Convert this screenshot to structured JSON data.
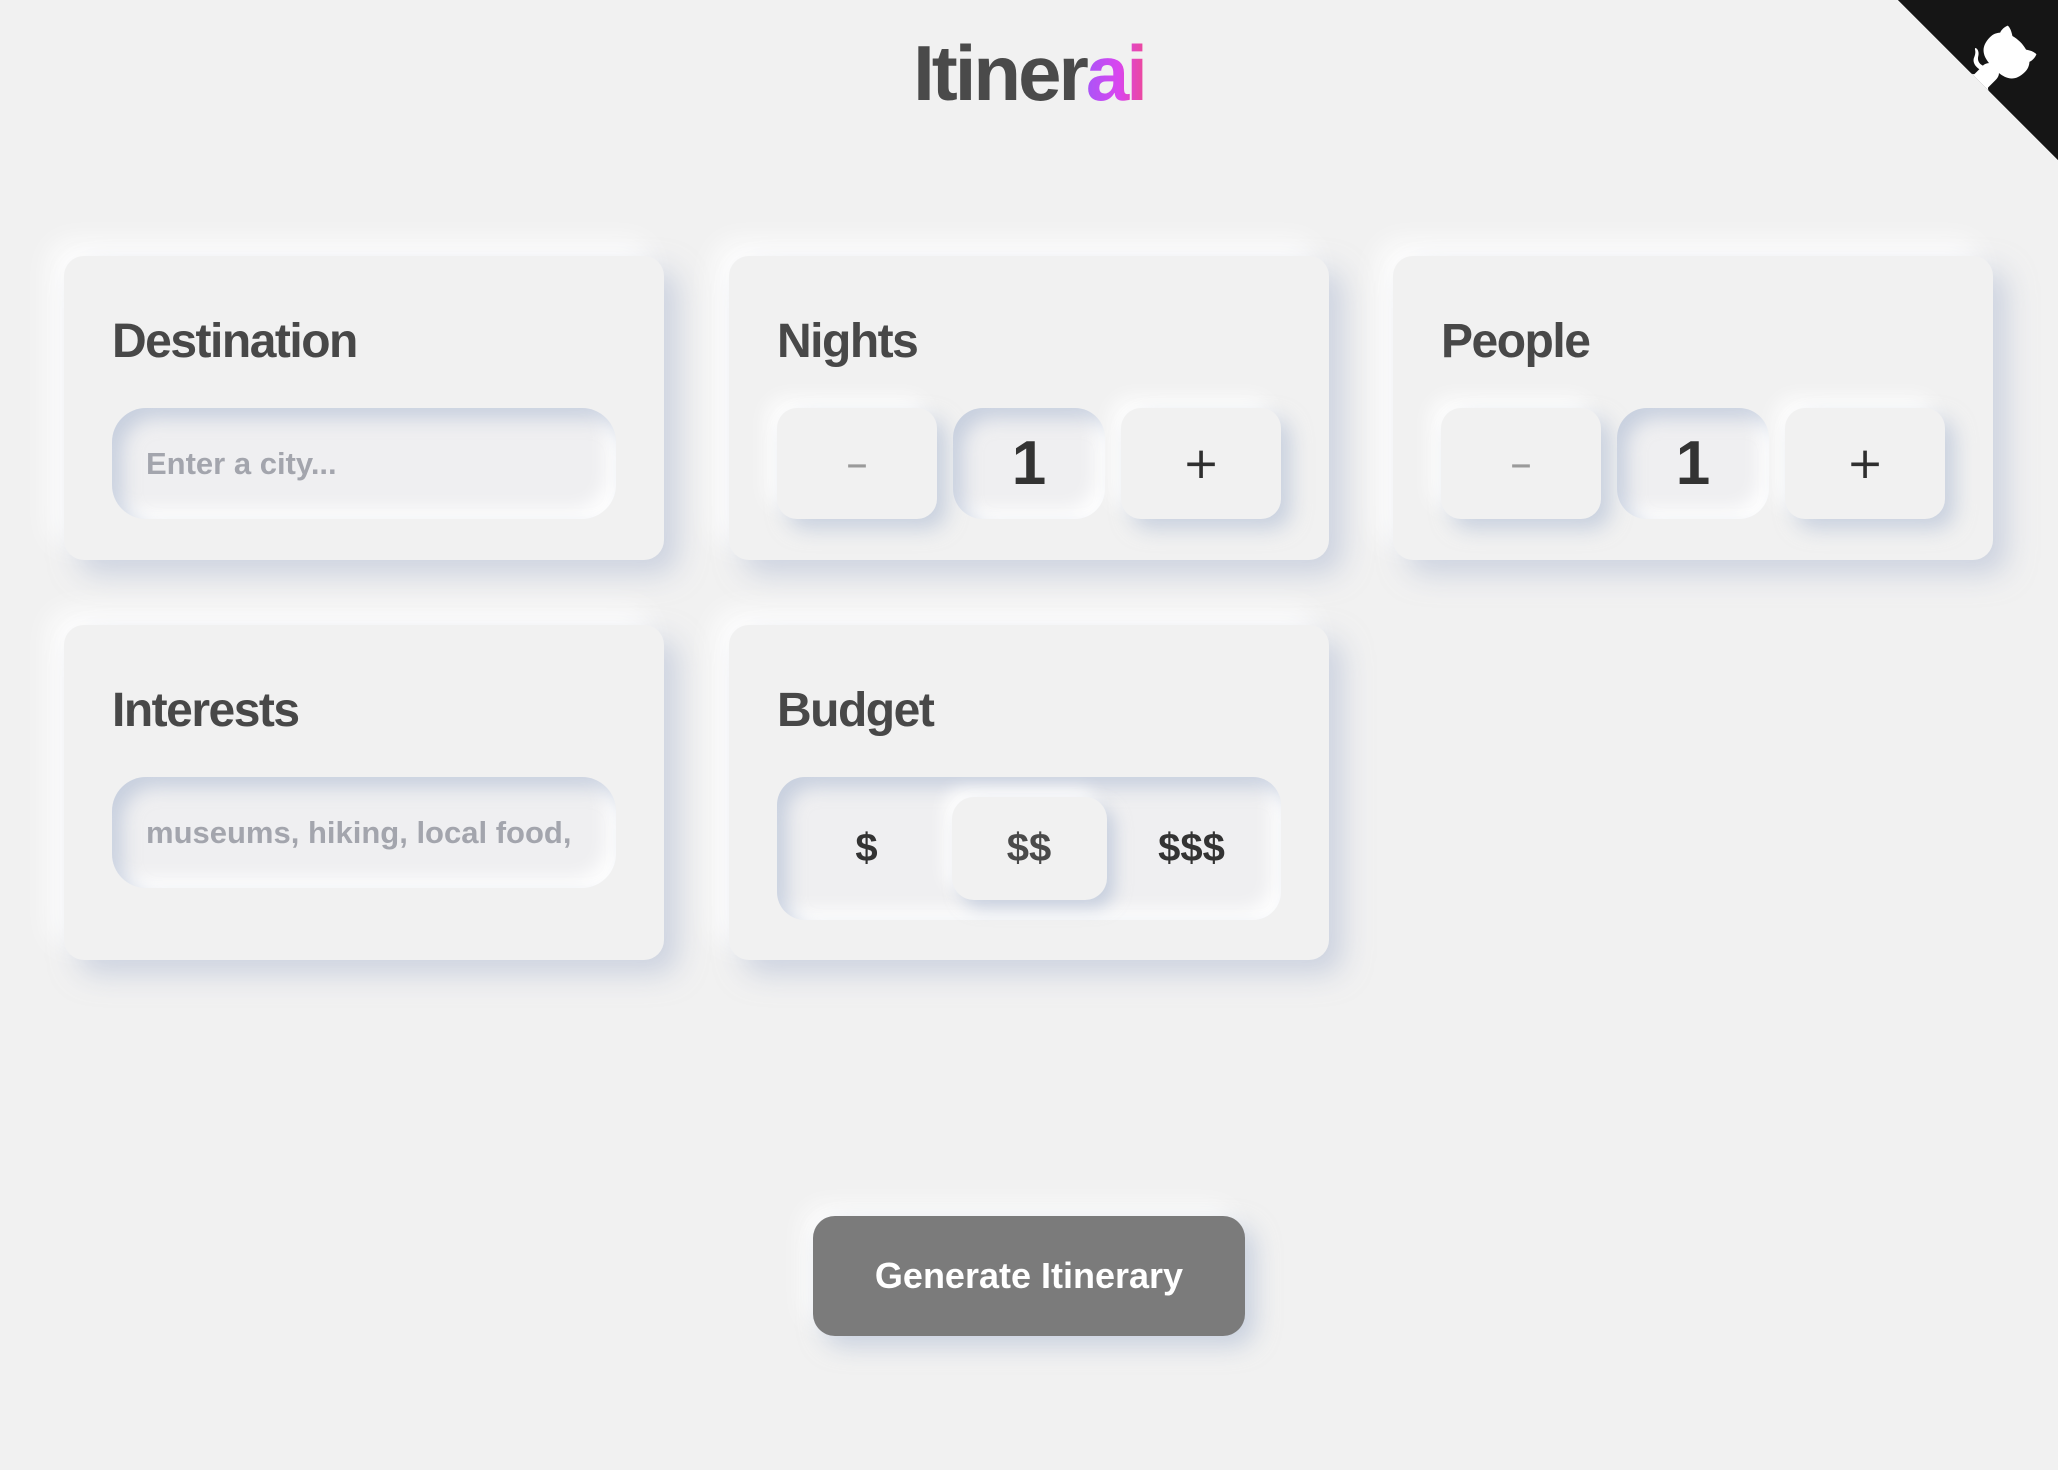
{
  "header": {
    "logo_main": "Itiner",
    "logo_accent": "ai"
  },
  "github_corner": {
    "icon": "github-octocat-icon"
  },
  "destination": {
    "title": "Destination",
    "placeholder": "Enter a city...",
    "value": ""
  },
  "nights": {
    "title": "Nights",
    "decrement_label": "–",
    "increment_label": "+",
    "value": "1"
  },
  "people": {
    "title": "People",
    "decrement_label": "–",
    "increment_label": "+",
    "value": "1"
  },
  "interests": {
    "title": "Interests",
    "placeholder": "museums, hiking, local food, nightlife...",
    "value": ""
  },
  "budget": {
    "title": "Budget",
    "options": [
      "$",
      "$$",
      "$$$"
    ],
    "selected": "$$"
  },
  "actions": {
    "generate_label": "Generate Itinerary"
  },
  "colors": {
    "background": "#f1f1f1",
    "text": "#4a4a4a",
    "button": "#7b7b7b",
    "accent_gradient_start": "#a855f7",
    "accent_gradient_end": "#ec4899",
    "corner": "#151515"
  }
}
